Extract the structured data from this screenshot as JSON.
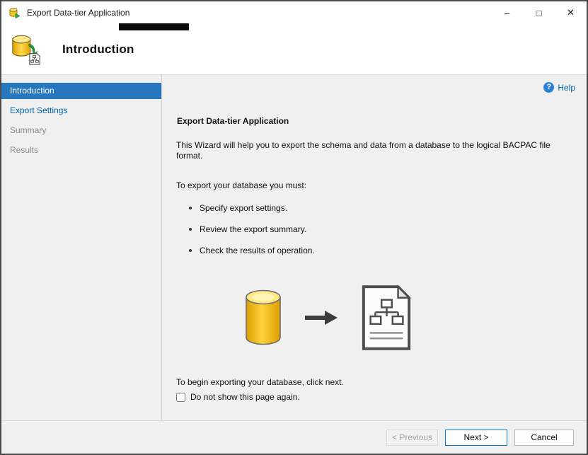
{
  "window": {
    "title": "Export Data-tier Application",
    "controls": {
      "minimize": "–",
      "maximize": "□",
      "close": "✕"
    }
  },
  "header": {
    "title": "Introduction"
  },
  "sidebar": {
    "items": [
      {
        "label": "Introduction",
        "state": "selected"
      },
      {
        "label": "Export Settings",
        "state": "enabled-link"
      },
      {
        "label": "Summary",
        "state": "disabled"
      },
      {
        "label": "Results",
        "state": "disabled"
      }
    ]
  },
  "content": {
    "help_label": "Help",
    "help_glyph": "?",
    "heading": "Export Data-tier Application",
    "intro": "This Wizard will help you to export the schema and data from a database to the logical BACPAC file format.",
    "must_label": "To export your database you must:",
    "bullets": [
      "Specify export settings.",
      "Review the export summary.",
      "Check the results of operation."
    ],
    "begin_text": "To begin exporting your database, click next.",
    "checkbox_label": "Do not show this page again.",
    "checkbox_checked": false,
    "icons": [
      "database-cylinder-icon",
      "right-arrow-icon",
      "bacpac-document-icon"
    ]
  },
  "footer": {
    "previous_label": "< Previous",
    "previous_enabled": false,
    "next_label": "Next >",
    "cancel_label": "Cancel"
  },
  "colors": {
    "accent": "#0078d4",
    "selected_nav_blue": "#2677be",
    "link_blue": "#0063b1",
    "panel_gray": "#f0f0f0",
    "database_yellow": "#f7c71d"
  }
}
